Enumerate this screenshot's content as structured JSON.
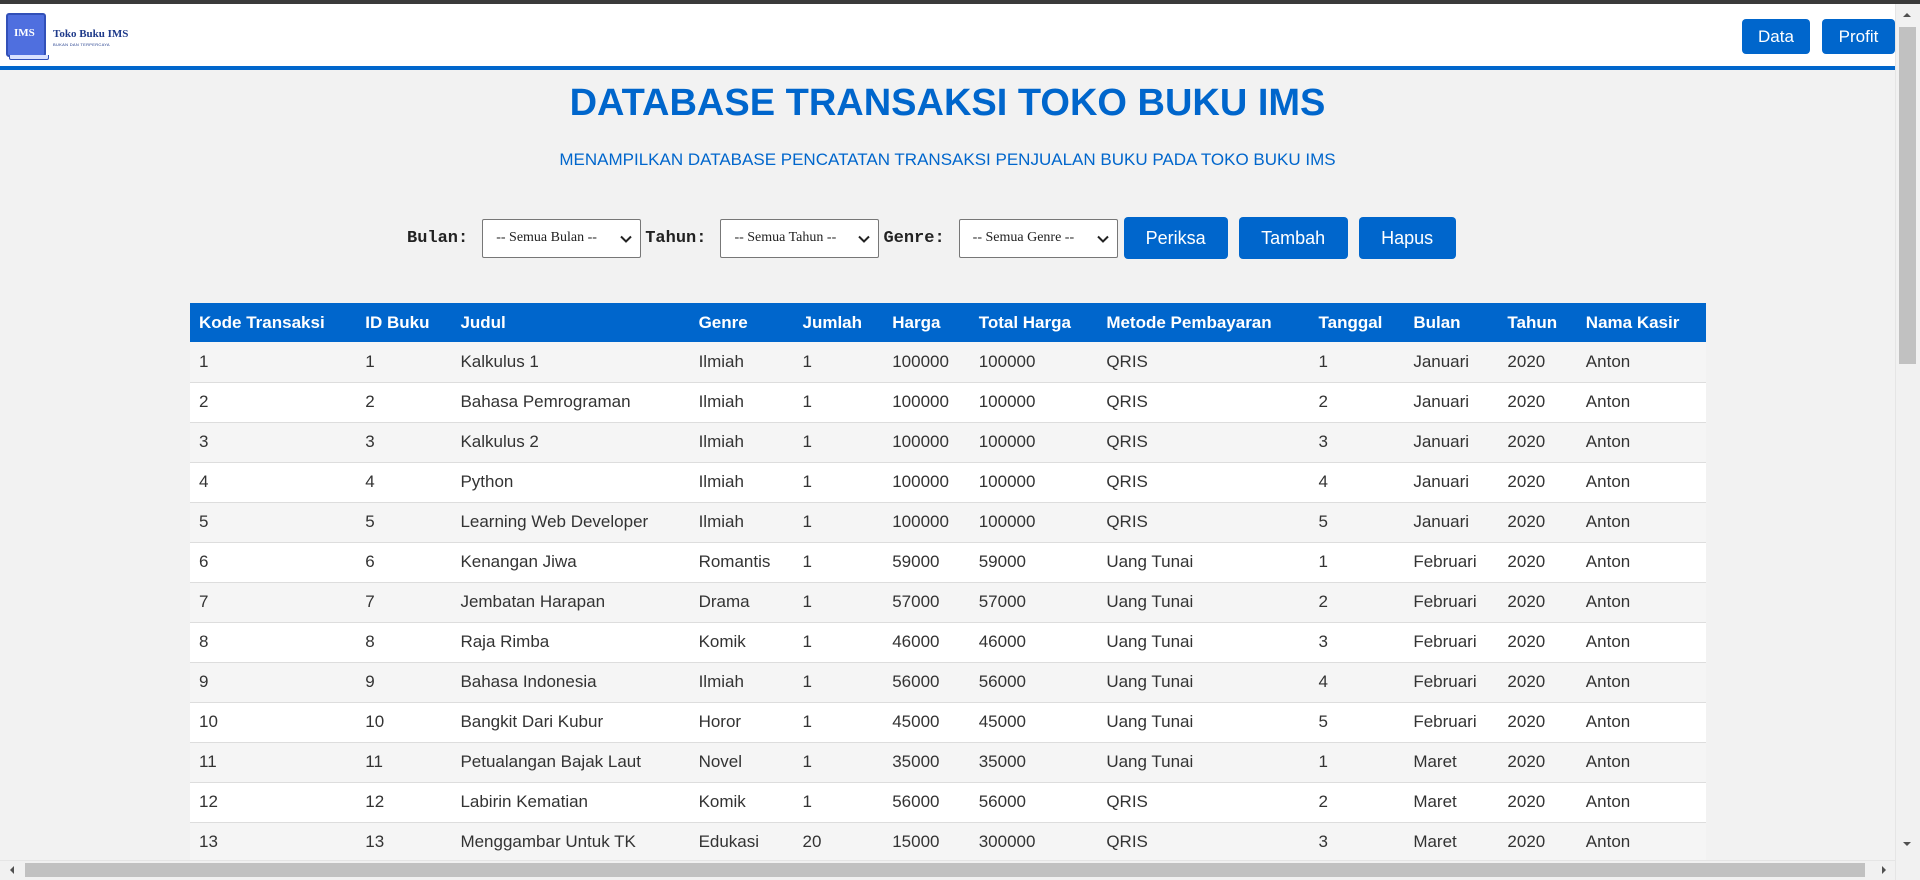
{
  "app": {
    "logo_badge": "IMS",
    "logo_name": "Toko Buku IMS",
    "logo_tagline": "BUKAN DAN TERPERCAYA"
  },
  "nav": {
    "data_label": "Data",
    "profit_label": "Profit"
  },
  "page": {
    "title": "DATABASE TRANSAKSI TOKO BUKU IMS",
    "subtitle": "MENAMPILKAN DATABASE PENCATATAN TRANSAKSI PENJUALAN BUKU PADA TOKO BUKU IMS"
  },
  "filters": {
    "bulan_label": "Bulan:",
    "bulan_value": "-- Semua Bulan --",
    "tahun_label": "Tahun:",
    "tahun_value": "-- Semua Tahun --",
    "genre_label": "Genre:",
    "genre_value": "-- Semua Genre --",
    "periksa_label": "Periksa",
    "tambah_label": "Tambah",
    "hapus_label": "Hapus"
  },
  "table": {
    "columns": [
      "Kode Transaksi",
      "ID Buku",
      "Judul",
      "Genre",
      "Jumlah",
      "Harga",
      "Total Harga",
      "Metode Pembayaran",
      "Tanggal",
      "Bulan",
      "Tahun",
      "Nama Kasir"
    ],
    "rows": [
      [
        "1",
        "1",
        "Kalkulus 1",
        "Ilmiah",
        "1",
        "100000",
        "100000",
        "QRIS",
        "1",
        "Januari",
        "2020",
        "Anton"
      ],
      [
        "2",
        "2",
        "Bahasa Pemrograman",
        "Ilmiah",
        "1",
        "100000",
        "100000",
        "QRIS",
        "2",
        "Januari",
        "2020",
        "Anton"
      ],
      [
        "3",
        "3",
        "Kalkulus 2",
        "Ilmiah",
        "1",
        "100000",
        "100000",
        "QRIS",
        "3",
        "Januari",
        "2020",
        "Anton"
      ],
      [
        "4",
        "4",
        "Python",
        "Ilmiah",
        "1",
        "100000",
        "100000",
        "QRIS",
        "4",
        "Januari",
        "2020",
        "Anton"
      ],
      [
        "5",
        "5",
        "Learning Web Developer",
        "Ilmiah",
        "1",
        "100000",
        "100000",
        "QRIS",
        "5",
        "Januari",
        "2020",
        "Anton"
      ],
      [
        "6",
        "6",
        "Kenangan Jiwa",
        "Romantis",
        "1",
        "59000",
        "59000",
        "Uang Tunai",
        "1",
        "Februari",
        "2020",
        "Anton"
      ],
      [
        "7",
        "7",
        "Jembatan Harapan",
        "Drama",
        "1",
        "57000",
        "57000",
        "Uang Tunai",
        "2",
        "Februari",
        "2020",
        "Anton"
      ],
      [
        "8",
        "8",
        "Raja Rimba",
        "Komik",
        "1",
        "46000",
        "46000",
        "Uang Tunai",
        "3",
        "Februari",
        "2020",
        "Anton"
      ],
      [
        "9",
        "9",
        "Bahasa Indonesia",
        "Ilmiah",
        "1",
        "56000",
        "56000",
        "Uang Tunai",
        "4",
        "Februari",
        "2020",
        "Anton"
      ],
      [
        "10",
        "10",
        "Bangkit Dari Kubur",
        "Horor",
        "1",
        "45000",
        "45000",
        "Uang Tunai",
        "5",
        "Februari",
        "2020",
        "Anton"
      ],
      [
        "11",
        "11",
        "Petualangan Bajak Laut",
        "Novel",
        "1",
        "35000",
        "35000",
        "Uang Tunai",
        "1",
        "Maret",
        "2020",
        "Anton"
      ],
      [
        "12",
        "12",
        "Labirin Kematian",
        "Komik",
        "1",
        "56000",
        "56000",
        "QRIS",
        "2",
        "Maret",
        "2020",
        "Anton"
      ],
      [
        "13",
        "13",
        "Menggambar Untuk TK",
        "Edukasi",
        "20",
        "15000",
        "300000",
        "QRIS",
        "3",
        "Maret",
        "2020",
        "Anton"
      ]
    ]
  },
  "colors": {
    "accent": "#0066cc",
    "background": "#f2f2f2",
    "row_alt": "#f5f5f5"
  }
}
